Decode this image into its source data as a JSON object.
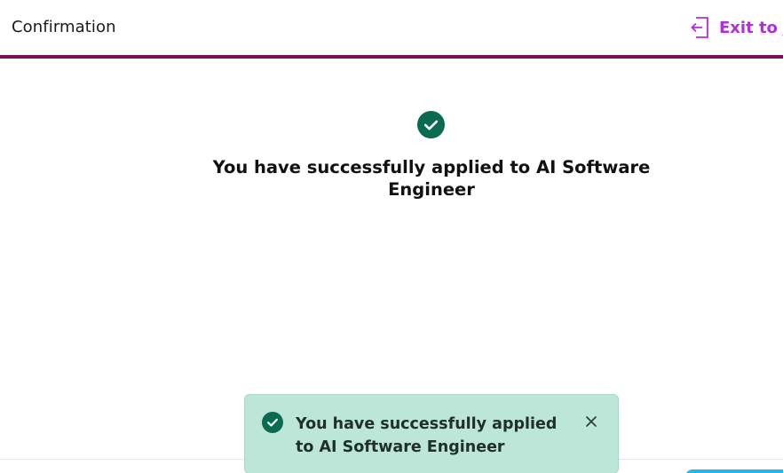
{
  "header": {
    "title": "Confirmation",
    "exit_label": "Exit to job"
  },
  "success": {
    "icon": "check-circle-icon",
    "message": "You have successfully applied to AI Software Engineer"
  },
  "toast": {
    "icon": "check-circle-icon",
    "message": "You have successfully applied to AI Software Engineer",
    "close_icon": "close-icon"
  },
  "colors": {
    "header_border": "#7a0f5a",
    "exit_link": "#b02ee0",
    "success_green": "#0b6b50",
    "toast_background": "#bce6d8",
    "footer_button": "#25b7ea"
  }
}
